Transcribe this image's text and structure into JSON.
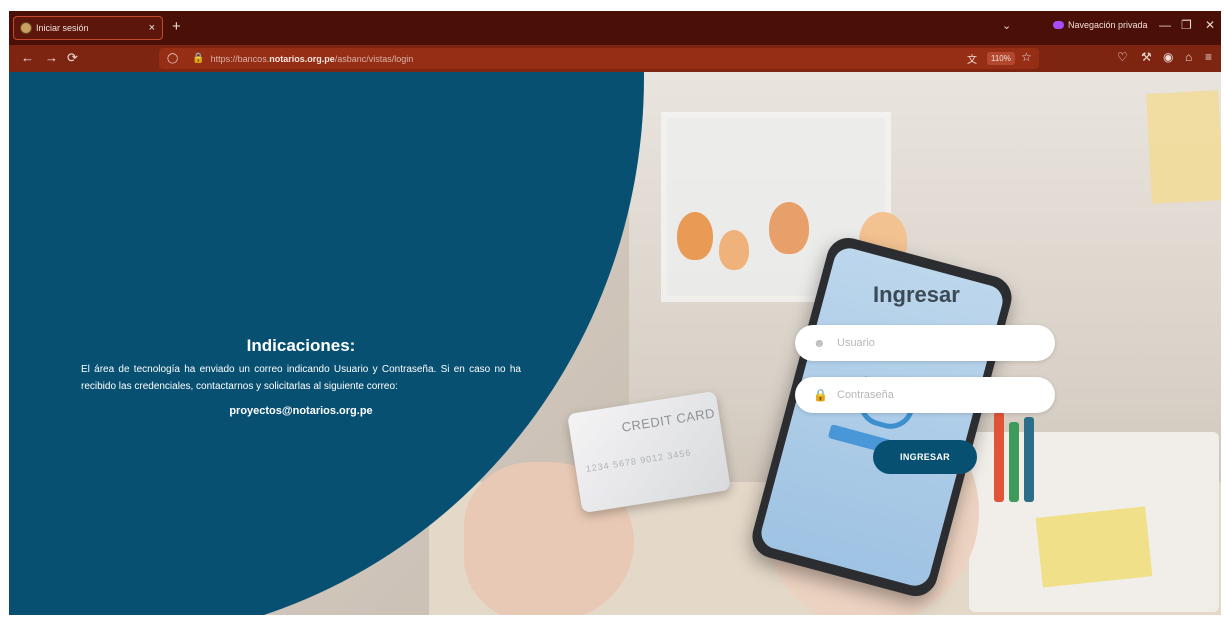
{
  "browser": {
    "tab_title": "Iniciar sesión",
    "tab_close": "×",
    "new_tab": "+",
    "private_label": "Navegación privada",
    "url_prefix": "https://bancos.",
    "url_host": "notarios.org.pe",
    "url_path": "/asbanc/vistas/login",
    "zoom": "110%"
  },
  "info": {
    "title": "Indicaciones:",
    "text": "El área de tecnología ha enviado un correo indicando Usuario y Contraseña. Si en caso no ha recibido las credenciales, contactarnos y solicitarlas al siguiente correo:",
    "email": "proyectos@notarios.org.pe"
  },
  "login": {
    "title": "Ingresar",
    "user_placeholder": "Usuario",
    "password_placeholder": "Contraseña",
    "submit_label": "INGRESAR"
  },
  "photo": {
    "card_text": "CREDIT CARD",
    "card_number": "1234 5678 9012 3456"
  },
  "colors": {
    "brand_blue": "#075072",
    "tab_bar": "#4a0f07",
    "nav_bar": "#7e2512"
  }
}
